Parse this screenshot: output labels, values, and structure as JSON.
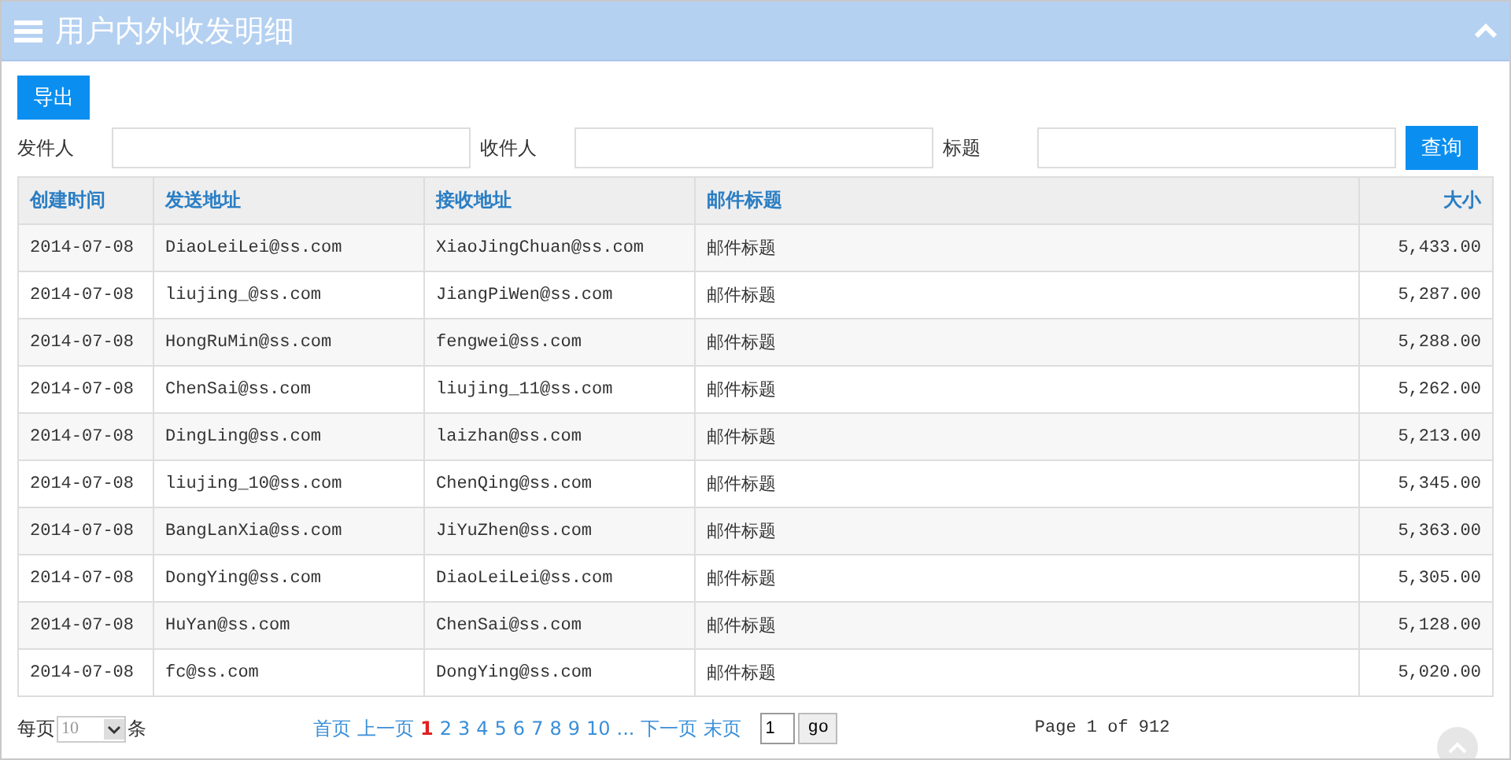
{
  "panel": {
    "title": "用户内外收发明细",
    "collapsed": false
  },
  "toolbar": {
    "export_button": "导出"
  },
  "filters": [
    {
      "label": "发件人"
    },
    {
      "label": "收件人"
    },
    {
      "label": "标题"
    }
  ],
  "search_button": "查询",
  "table": {
    "columns": [
      {
        "label": "创建时间"
      },
      {
        "label": "发送地址"
      },
      {
        "label": "接收地址"
      },
      {
        "label": "邮件标题"
      },
      {
        "label": "大小"
      }
    ],
    "rows": [
      [
        "2014-07-08",
        "DiaoLeiLei@ss.com",
        "XiaoJingChuan@ss.com",
        "邮件标题",
        "5,433.00"
      ],
      [
        "2014-07-08",
        "liujing_@ss.com",
        "JiangPiWen@ss.com",
        "邮件标题",
        "5,287.00"
      ],
      [
        "2014-07-08",
        "HongRuMin@ss.com",
        "fengwei@ss.com",
        "邮件标题",
        "5,288.00"
      ],
      [
        "2014-07-08",
        "ChenSai@ss.com",
        "liujing_11@ss.com",
        "邮件标题",
        "5,262.00"
      ],
      [
        "2014-07-08",
        "DingLing@ss.com",
        "laizhan@ss.com",
        "邮件标题",
        "5,213.00"
      ],
      [
        "2014-07-08",
        "liujing_10@ss.com",
        "ChenQing@ss.com",
        "邮件标题",
        "5,345.00"
      ],
      [
        "2014-07-08",
        "BangLanXia@ss.com",
        "JiYuZhen@ss.com",
        "邮件标题",
        "5,363.00"
      ],
      [
        "2014-07-08",
        "DongYing@ss.com",
        "DiaoLeiLei@ss.com",
        "邮件标题",
        "5,305.00"
      ],
      [
        "2014-07-08",
        "HuYan@ss.com",
        "ChenSai@ss.com",
        "邮件标题",
        "5,128.00"
      ],
      [
        "2014-07-08",
        "fc@ss.com",
        "DongYing@ss.com",
        "邮件标题",
        "5,020.00"
      ]
    ]
  },
  "footer": {
    "per_page_label": "每页",
    "page_size": "10",
    "per_page_unit": "条",
    "first": "首页",
    "prev": "上一页",
    "pages": [
      {
        "label": "1",
        "selected": true
      },
      {
        "label": "2",
        "selected": false
      },
      {
        "label": "3",
        "selected": false
      },
      {
        "label": "4",
        "selected": false
      },
      {
        "label": "5",
        "selected": false
      },
      {
        "label": "6",
        "selected": false
      },
      {
        "label": "7",
        "selected": false
      },
      {
        "label": "8",
        "selected": false
      },
      {
        "label": "9",
        "selected": false
      },
      {
        "label": "10",
        "selected": false
      }
    ],
    "ellipsis": "...",
    "next": "下一页",
    "last": "末页",
    "goto_value": "1",
    "go_button": "go",
    "page_info": "Page 1 of 912"
  }
}
